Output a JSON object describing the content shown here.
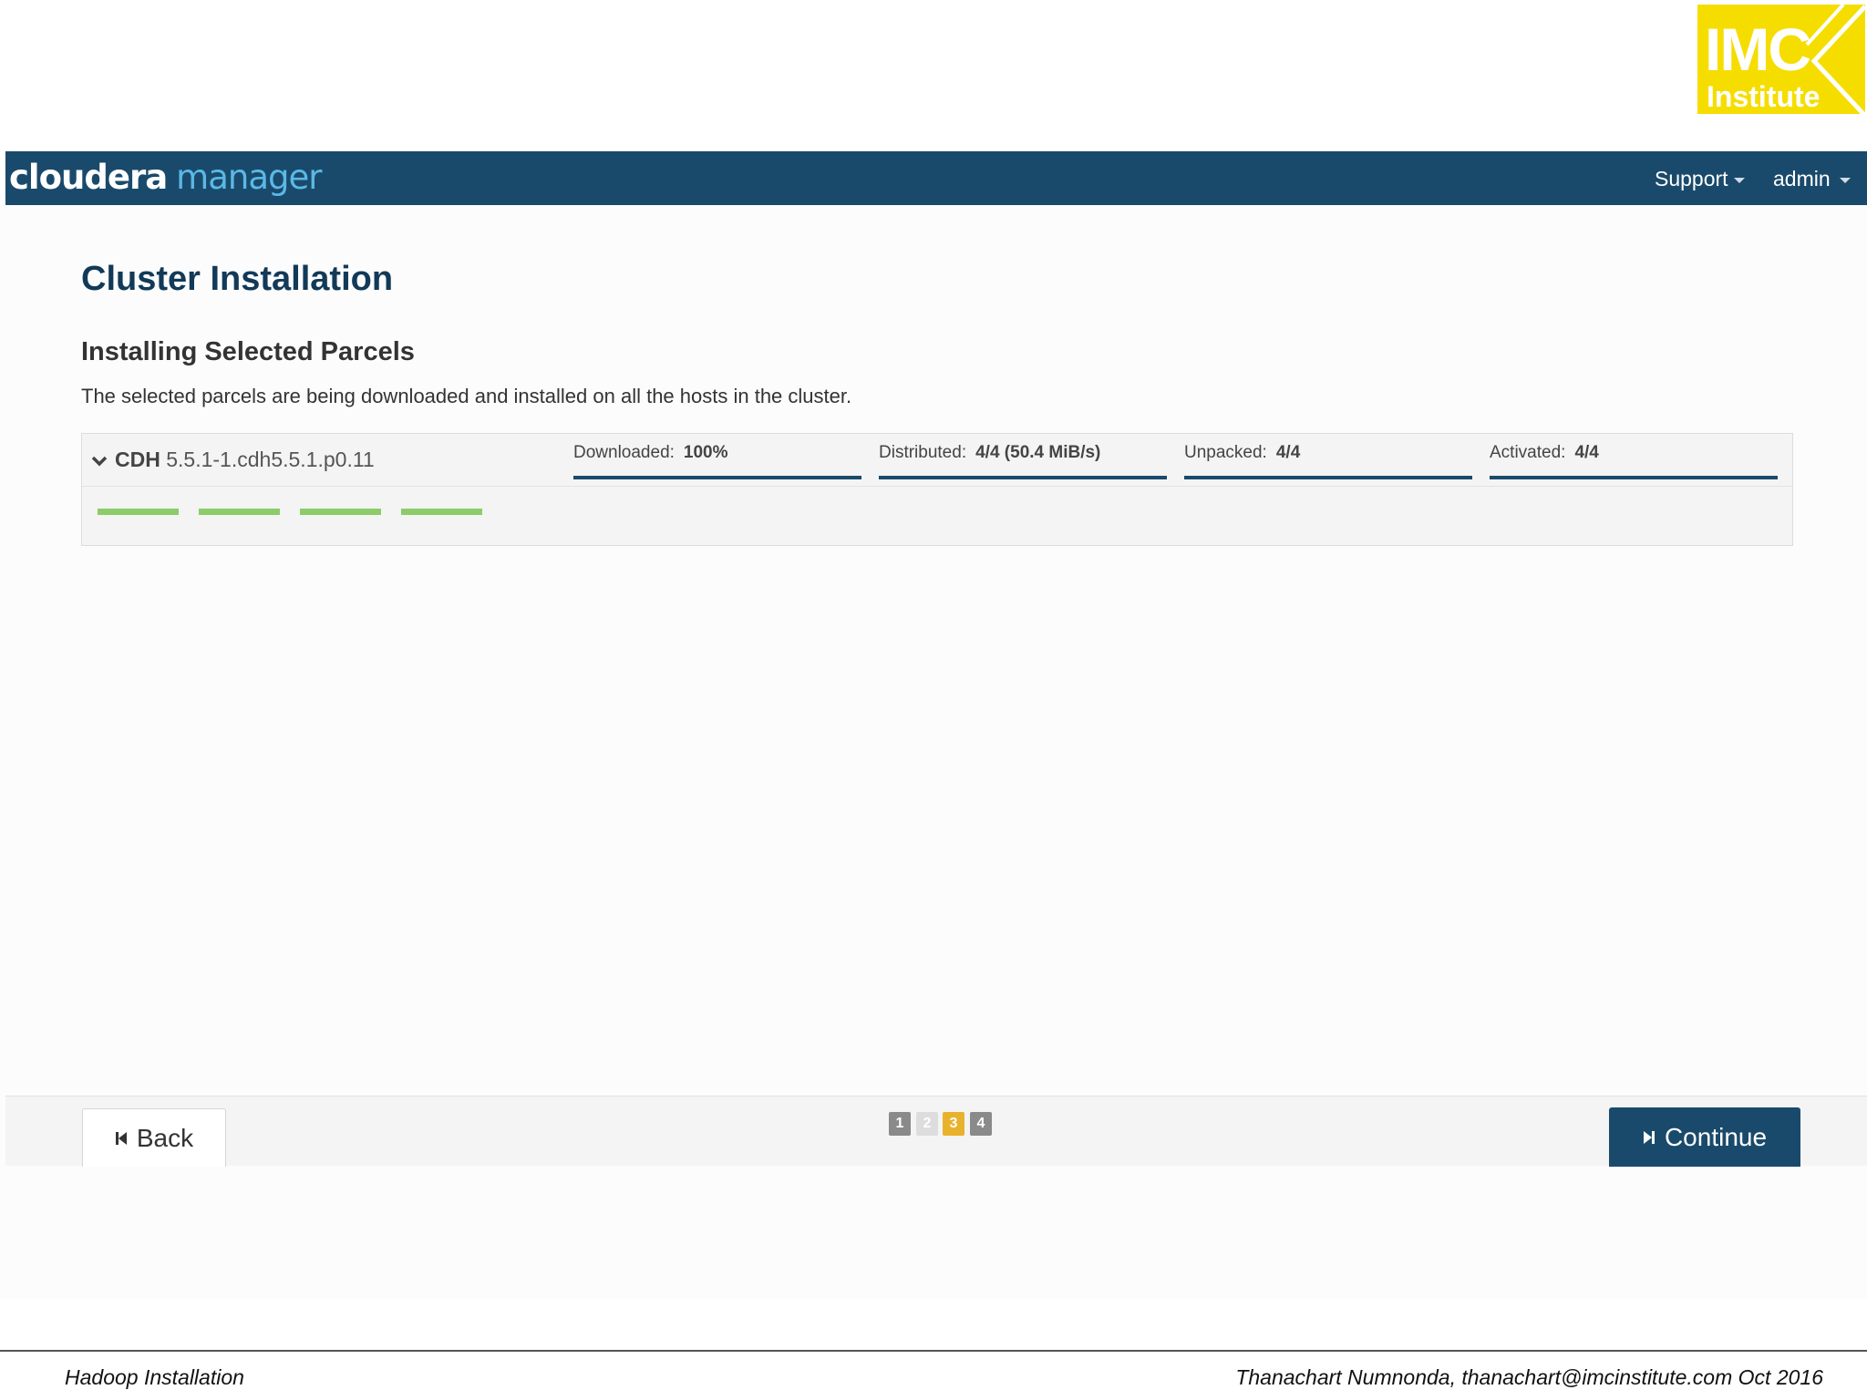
{
  "logo": {
    "line1": "IMC",
    "line2": "Institute",
    "color": "#f6dd00"
  },
  "header": {
    "brand_part1": "cloudera",
    "brand_part2": "manager",
    "support_label": "Support",
    "admin_label": "admin",
    "bg_color": "#1a4a6b"
  },
  "main": {
    "title": "Cluster Installation",
    "section_title": "Installing Selected Parcels",
    "description": "The selected parcels are being downloaded and installed on all the hosts in the cluster.",
    "parcel": {
      "name": "CDH",
      "version": "5.5.1-1.cdh5.5.1.p0.11",
      "stages": [
        {
          "label": "Downloaded:",
          "value": "100%",
          "progress": 1.0
        },
        {
          "label": "Distributed:",
          "value": "4/4 (50.4 MiB/s)",
          "progress": 1.0
        },
        {
          "label": "Unpacked:",
          "value": "4/4",
          "progress": 1.0
        },
        {
          "label": "Activated:",
          "value": "4/4",
          "progress": 1.0
        }
      ],
      "host_count": 4,
      "host_bar_color": "#8ccc6a"
    }
  },
  "footer_bar": {
    "back_label": "Back",
    "continue_label": "Continue",
    "steps": [
      {
        "label": "1",
        "state": "done",
        "color": "#8a8a8a"
      },
      {
        "label": "2",
        "state": "inactive",
        "color": "#dddddd"
      },
      {
        "label": "3",
        "state": "current",
        "color": "#e8b22d"
      },
      {
        "label": "4",
        "state": "done",
        "color": "#8a8a8a"
      }
    ]
  },
  "slide_footer": {
    "left": "Hadoop Installation",
    "right": "Thanachart Numnonda,  thanachart@imcinstitute.com  Oct 2016"
  }
}
